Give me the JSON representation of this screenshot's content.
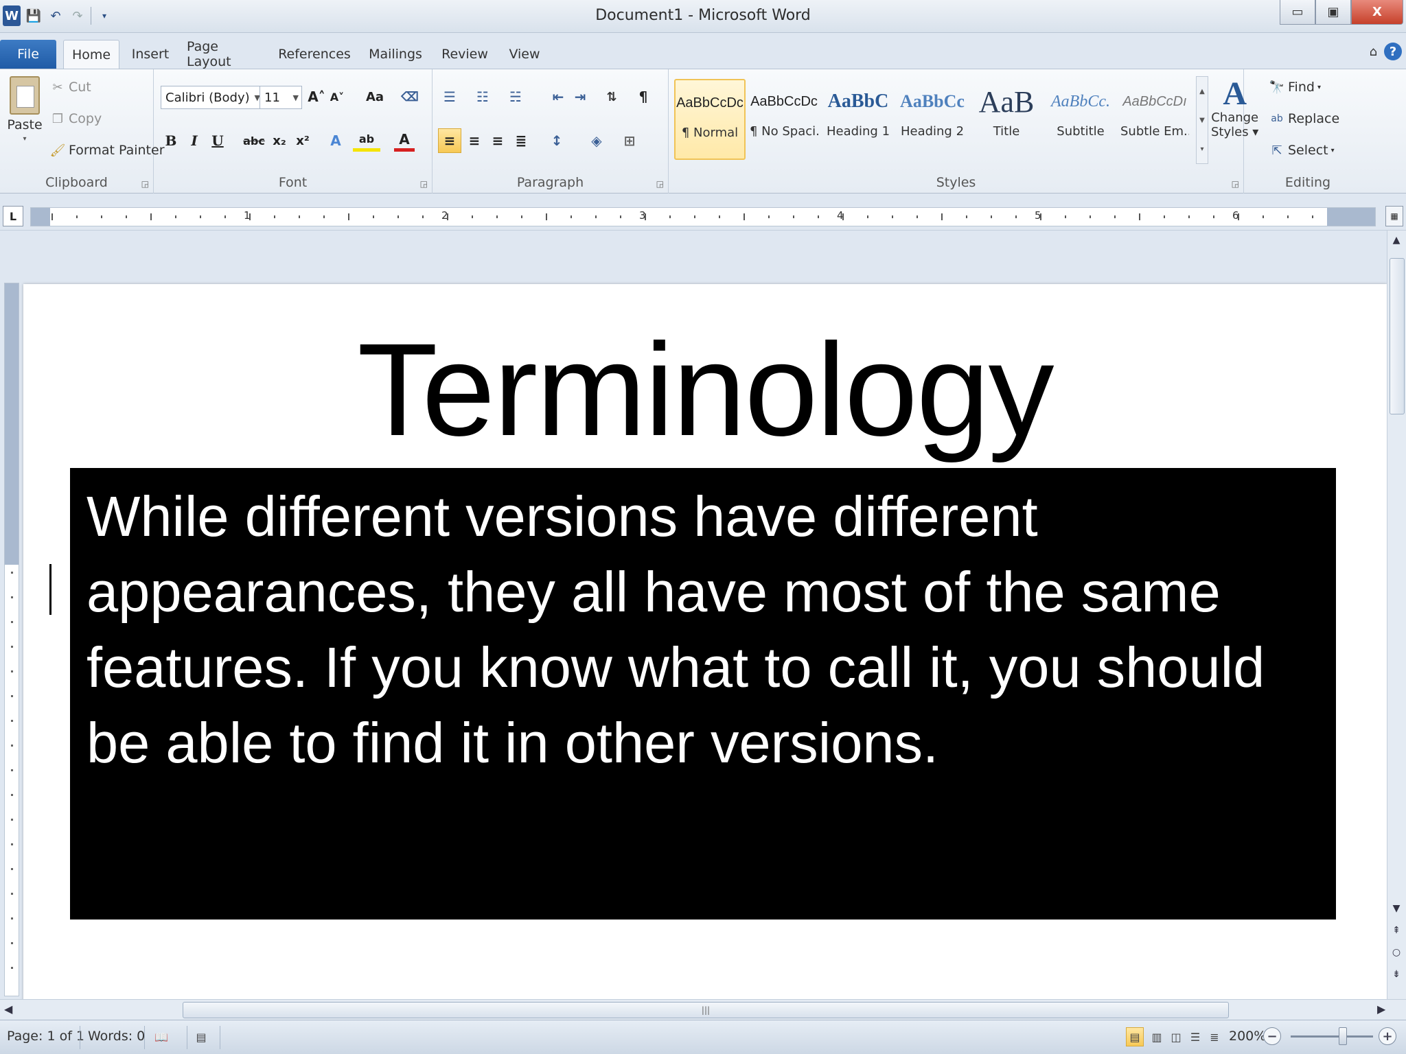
{
  "window": {
    "title": "Document1 - Microsoft Word",
    "app_icon": "W",
    "minimize": "▭",
    "restore": "▣",
    "close": "X"
  },
  "tabs": [
    "File",
    "Home",
    "Insert",
    "Page Layout",
    "References",
    "Mailings",
    "Review",
    "View"
  ],
  "active_tab": "Home",
  "clipboard": {
    "label": "Clipboard",
    "paste": "Paste",
    "cut": "Cut",
    "copy": "Copy",
    "format_painter": "Format Painter"
  },
  "font": {
    "label": "Font",
    "font_name": "Calibri (Body)",
    "font_size": "11",
    "bold": "B",
    "italic": "I",
    "underline": "U",
    "strikethrough": "abc",
    "subscript": "x₂",
    "superscript": "x²",
    "grow": "A˄",
    "shrink": "A˅",
    "change_case": "Aa",
    "font_color": "A",
    "highlight": "ab"
  },
  "paragraph": {
    "label": "Paragraph",
    "show_marks": "¶"
  },
  "styles": {
    "label": "Styles",
    "items": [
      {
        "sample": "AaBbCcDc",
        "name": "¶ Normal"
      },
      {
        "sample": "AaBbCcDc",
        "name": "¶ No Spaci..."
      },
      {
        "sample": "AaBbC",
        "name": "Heading 1"
      },
      {
        "sample": "AaBbCc",
        "name": "Heading 2"
      },
      {
        "sample": "AaB",
        "name": "Title"
      },
      {
        "sample": "AaBbCc.",
        "name": "Subtitle"
      },
      {
        "sample": "AaBbCcDı",
        "name": "Subtle Em..."
      }
    ],
    "change_styles": "Change Styles",
    "change_styles_line1": "Change",
    "change_styles_line2": "Styles ▾"
  },
  "editing": {
    "label": "Editing",
    "find": "Find",
    "replace": "Replace",
    "select": "Select"
  },
  "ruler": {
    "tab_selector": "L",
    "numbers": [
      "1",
      "2",
      "3",
      "4",
      "5",
      "6"
    ]
  },
  "document": {
    "title": "Terminology",
    "body": "While different versions have different appearances, they all have most of the same features. If you know what to call it, you should be able to find it in other versions."
  },
  "status": {
    "page": "Page: 1 of 1",
    "words": "Words: 0",
    "zoom": "200%",
    "zoom_out": "−",
    "zoom_in": "+"
  },
  "colors": {
    "file_tab": "#2b5797",
    "selection_gold": "#f0c356",
    "doc_box": "#000000"
  },
  "icons": [
    "word-logo-icon",
    "save-icon",
    "undo-icon",
    "redo-icon",
    "paste-icon",
    "cut-icon",
    "copy-icon",
    "format-painter-icon",
    "find-icon",
    "replace-icon",
    "select-icon",
    "help-icon"
  ]
}
